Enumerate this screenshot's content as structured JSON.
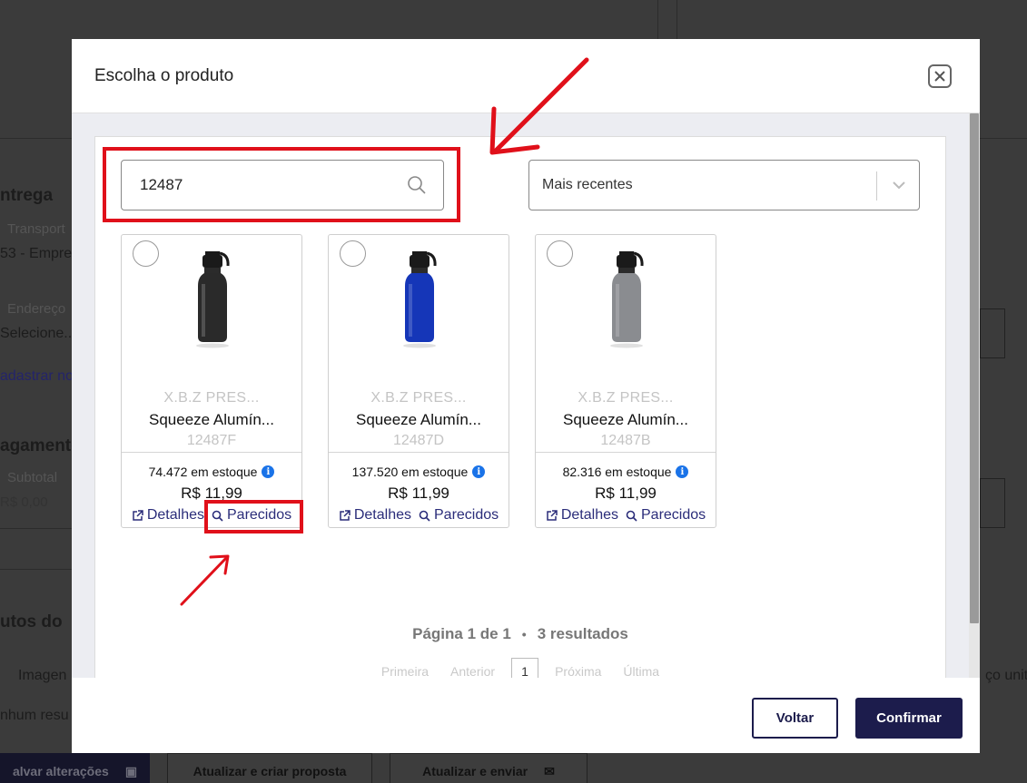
{
  "background": {
    "section_delivery": "ntrega",
    "transport_label": "Transport",
    "company": "53 - Empres",
    "address_label": "Endereço",
    "address_select": "Selecione...",
    "register_link": "adastrar no",
    "payment_section": "agamento",
    "subtotal_label": "Subtotal",
    "subtotal_value": "R$ 0,00",
    "products_section": "utos do",
    "column_image": "Imagen",
    "column_unit_price": "ço unit",
    "empty_results": "nhum resu",
    "save_button": "alvar alterações",
    "update_create_button": "Atualizar e criar proposta",
    "update_send_button": "Atualizar e enviar"
  },
  "modal": {
    "title": "Escolha o produto",
    "search": {
      "value": "12487"
    },
    "sort": {
      "selected": "Mais recentes"
    },
    "products": [
      {
        "brand": "X.B.Z PRES...",
        "name": "Squeeze Alumín...",
        "code": "12487F",
        "stock": "74.472 em estoque",
        "price": "R$ 11,99",
        "details": "Detalhes",
        "similar": "Parecidos",
        "color": "#2a2a2a"
      },
      {
        "brand": "X.B.Z PRES...",
        "name": "Squeeze Alumín...",
        "code": "12487D",
        "stock": "137.520 em estoque",
        "price": "R$ 11,99",
        "details": "Detalhes",
        "similar": "Parecidos",
        "color": "#1536b8"
      },
      {
        "brand": "X.B.Z PRES...",
        "name": "Squeeze Alumín...",
        "code": "12487B",
        "stock": "82.316 em estoque",
        "price": "R$ 11,99",
        "details": "Detalhes",
        "similar": "Parecidos",
        "color": "#8a8c90"
      }
    ],
    "page_info": "Página 1 de 1",
    "results_info": "3 resultados",
    "pagination": {
      "first": "Primeira",
      "prev": "Anterior",
      "current": "1",
      "next": "Próxima",
      "last": "Última"
    },
    "back_button": "Voltar",
    "confirm_button": "Confirmar"
  },
  "colors": {
    "accent": "#1c1c4c",
    "link": "#2b2d7a",
    "highlight": "#e0101a",
    "info": "#1a73e8"
  }
}
